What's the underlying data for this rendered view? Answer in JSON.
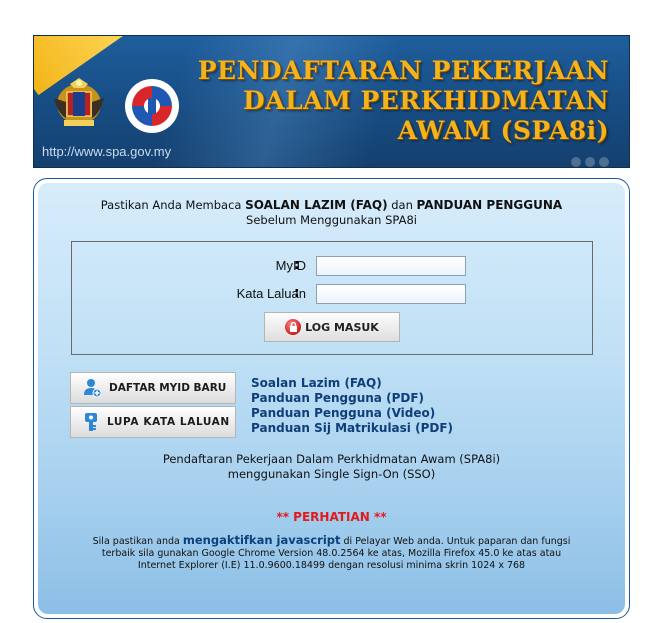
{
  "header": {
    "title_line1": "PENDAFTARAN PEKERJAAN",
    "title_line2": "DALAM PERKHIDMATAN",
    "title_line3": "AWAM (SPA8i)",
    "url": "http://www.spa.gov.my",
    "colors": {
      "title": "#f6b21a",
      "banner": "#184f87"
    }
  },
  "notice": {
    "prefix": "Pastikan Anda Membaca ",
    "faq": "SOALAN LAZIM (FAQ)",
    "and": " dan ",
    "guide": "PANDUAN PENGGUNA",
    "line2": "Sebelum Menggunakan SPA8i"
  },
  "login": {
    "myid_label": "MyID",
    "myid_colon": ":",
    "myid_value": "",
    "password_label": "Kata Laluan",
    "password_colon": ":",
    "password_value": "",
    "submit_label": "LOG MASUK"
  },
  "actions": {
    "register_label": "DAFTAR MYID BARU",
    "forgot_label": "LUPA KATA LALUAN"
  },
  "links": {
    "faq": "Soalan Lazim (FAQ)",
    "guide_pdf": "Panduan Pengguna (PDF)",
    "guide_video": "Panduan Pengguna (Video)",
    "matric_pdf": "Panduan Sij Matrikulasi (PDF)"
  },
  "sso": {
    "line1": "Pendaftaran Pekerjaan Dalam Perkhidmatan Awam (SPA8i)",
    "line2": "menggunakan Single Sign-On (SSO)"
  },
  "warning": {
    "title": "** PERHATIAN **",
    "pre_js": "Sila pastikan anda ",
    "js": "mengaktifkan javascript",
    "post_js": " di Pelayar Web anda. Untuk paparan dan fungsi",
    "line2": "terbaik sila gunakan Google Chrome Version 48.0.2564 ke atas, Mozilla Firefox 45.0 ke atas atau",
    "line3": "Internet Explorer (I.E) 11.0.9600.18499 dengan resolusi minima skrin 1024 x 768"
  }
}
